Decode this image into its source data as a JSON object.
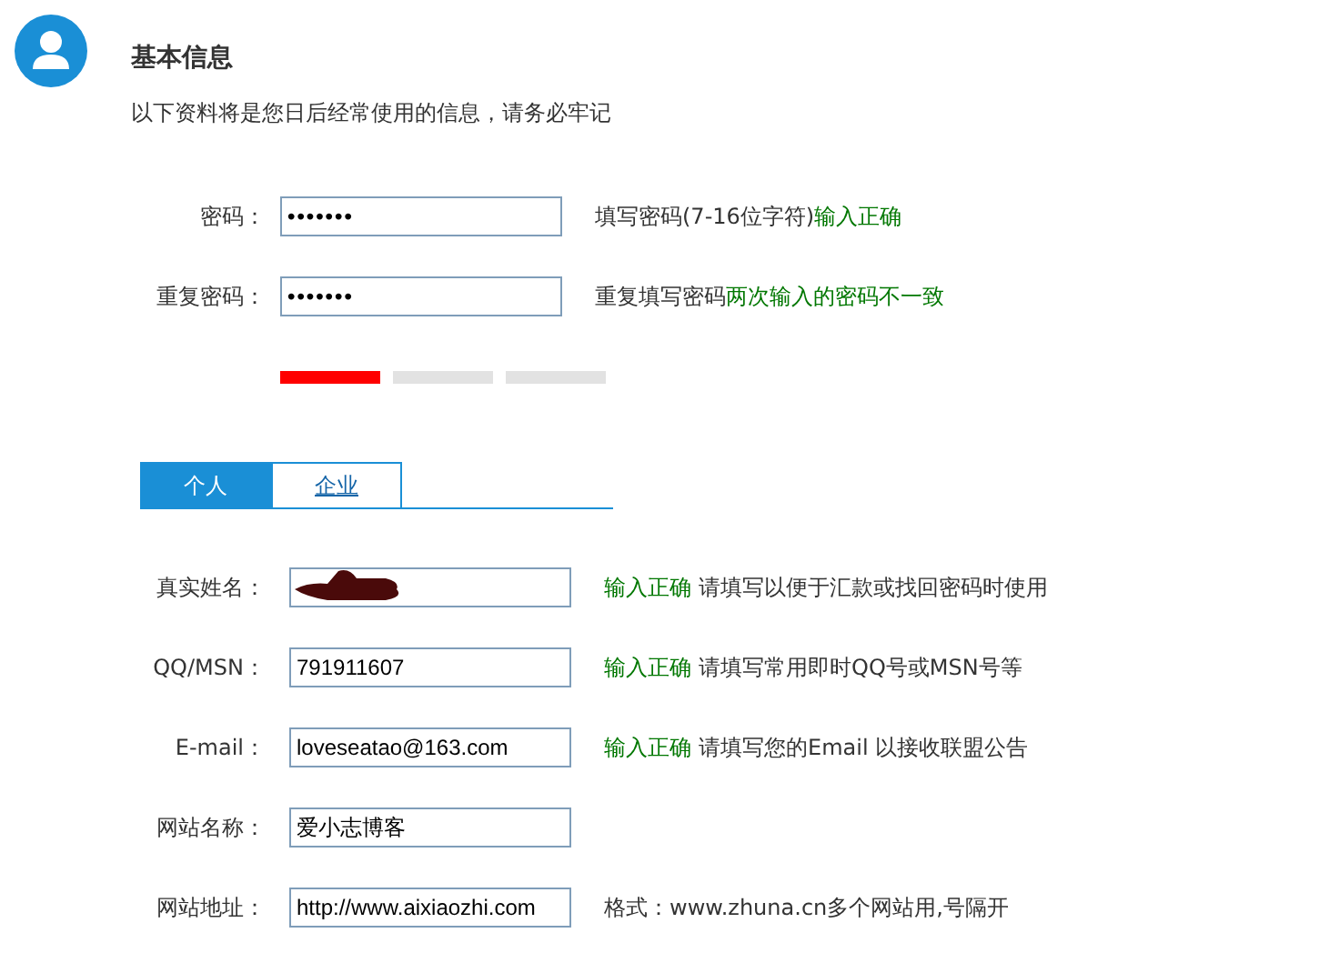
{
  "header": {
    "title": "基本信息",
    "subtitle": "以下资料将是您日后经常使用的信息，请务必牢记"
  },
  "password_fields": [
    {
      "label": "密码：",
      "value": "•••••••",
      "parts": [
        {
          "kind": "hint",
          "text": "填写密码(7-16位字符)"
        },
        {
          "kind": "ok",
          "text": "输入正确"
        }
      ]
    },
    {
      "label": "重复密码：",
      "value": "•••••••",
      "parts": [
        {
          "kind": "hint",
          "text": "重复填写密码"
        },
        {
          "kind": "ok",
          "text": "两次输入的密码不一致"
        }
      ]
    }
  ],
  "strength_meter": {
    "level": 0.33
  },
  "tabs": [
    {
      "label": "个人",
      "selected": true
    },
    {
      "label": "企业",
      "selected": false
    }
  ],
  "profile_fields": [
    {
      "label": "真实姓名：",
      "redacted": true,
      "parts": [
        {
          "kind": "ok",
          "text": "输入正确"
        },
        {
          "kind": "hint",
          "text": "请填写以便于汇款或找回密码时使用"
        }
      ]
    },
    {
      "label": "QQ/MSN：",
      "value": "791911607",
      "parts": [
        {
          "kind": "ok",
          "text": "输入正确"
        },
        {
          "kind": "hint",
          "text": "请填写常用即时QQ号或MSN号等"
        }
      ]
    },
    {
      "label": "E-mail：",
      "value": "loveseatao@163.com",
      "parts": [
        {
          "kind": "ok",
          "text": "输入正确"
        },
        {
          "kind": "hint",
          "text": "请填写您的Email 以接收联盟公告"
        }
      ]
    },
    {
      "label": "网站名称：",
      "value": "爱小志博客"
    },
    {
      "label": "网站地址：",
      "value": "http://www.aixiaozhi.com",
      "parts": [
        {
          "kind": "hint",
          "text": "格式：www.zhuna.cn多个网站用,号隔开"
        }
      ]
    }
  ]
}
